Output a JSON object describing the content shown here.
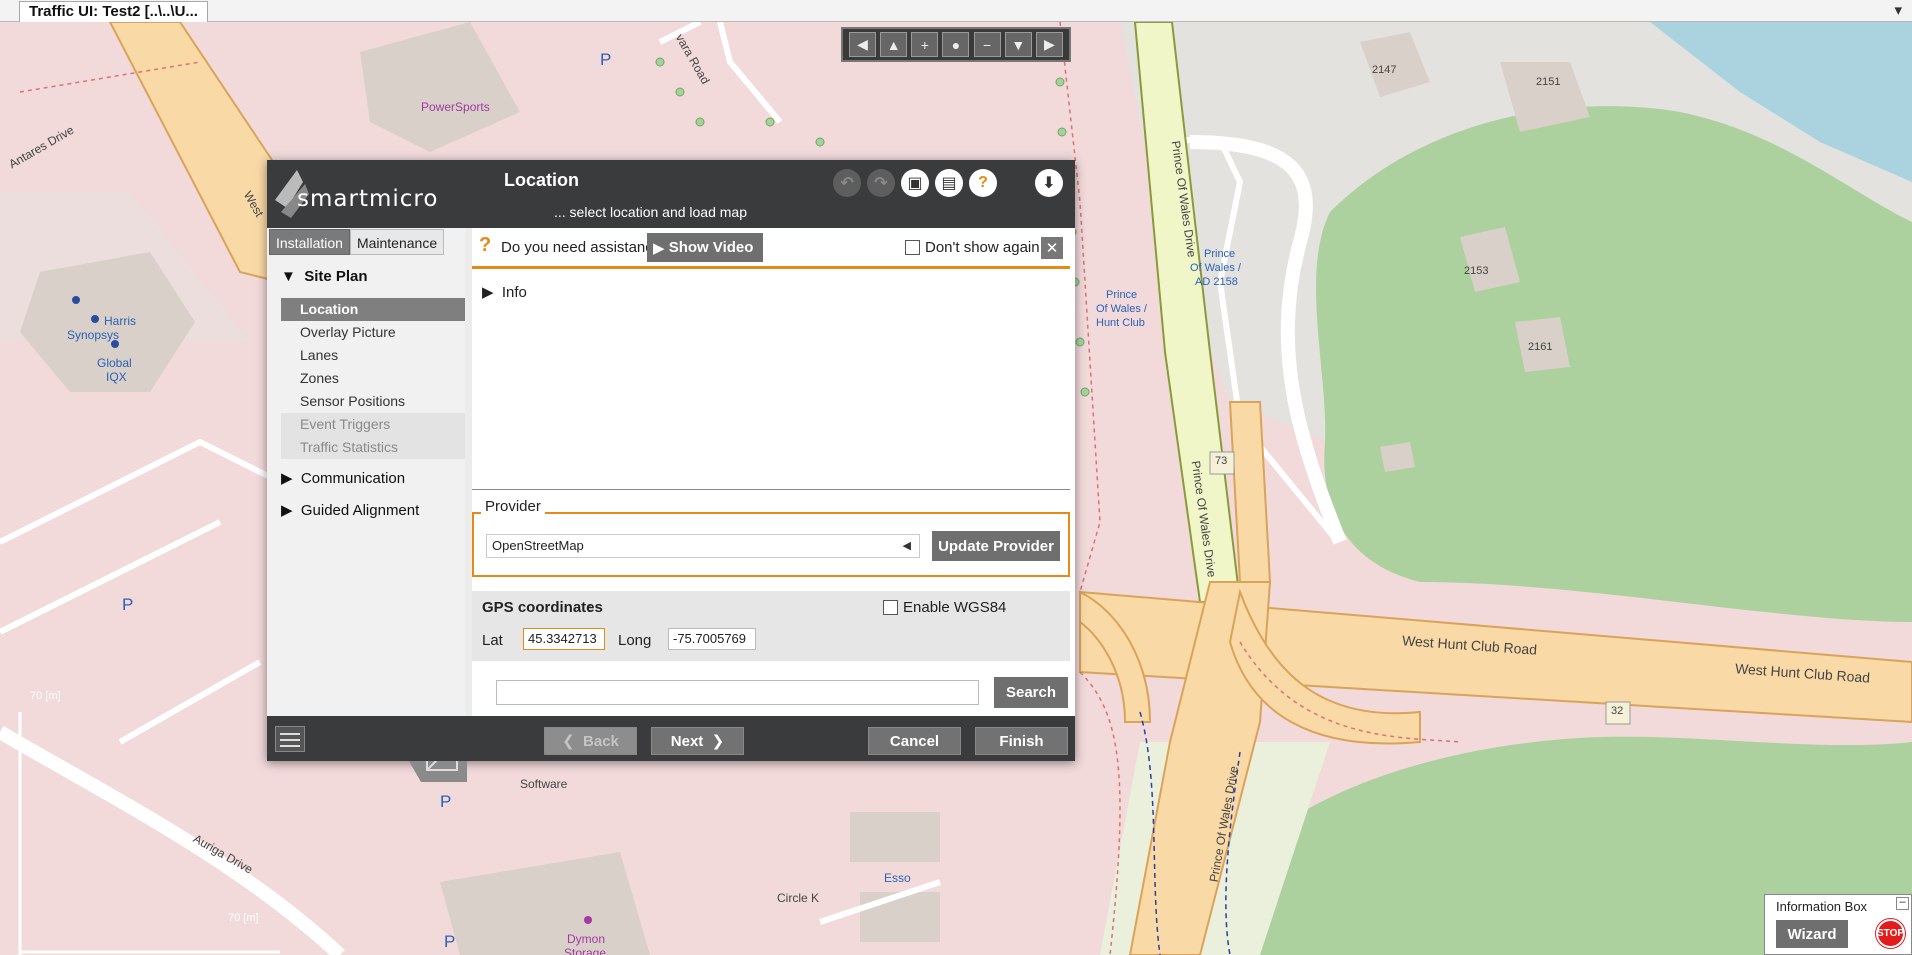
{
  "window": {
    "tab_title": "Traffic UI: Test2 [..\\..\\U..."
  },
  "map": {
    "streets": [
      "Antares Drive",
      "West",
      "Prince Of Wales Drive",
      "West Hunt Club Road",
      "Auriga Drive",
      "vara Road"
    ],
    "route_numbers": [
      "73",
      "32"
    ],
    "house_numbers": [
      "2147",
      "2151",
      "2153",
      "2161"
    ],
    "pois": [
      "PowerSports",
      "Harris",
      "Synopsys",
      "Global",
      "IQX",
      "Esso",
      "Circle K",
      "Dymon",
      "Storage",
      "Software"
    ],
    "bus_stops": [
      "Prince",
      "Of Wales /",
      "Hunt Club",
      "Prince",
      "Of Wales /",
      "AD 2158"
    ],
    "parking_symbol": "P",
    "scale_labels": [
      "70 [m]",
      "70 [m]"
    ]
  },
  "nav_controls": {
    "left": "◀",
    "up": "▲",
    "zoom_in": "+",
    "center": "●",
    "zoom_out": "−",
    "down": "▼",
    "right": "▶"
  },
  "dialog": {
    "brand": "smartmicro",
    "title": "Location",
    "subtitle": "... select location and load map",
    "icons": {
      "undo": "undo-icon",
      "redo": "redo-icon",
      "save": "save-icon",
      "save_as": "save-as-icon",
      "help": "help-icon",
      "download": "download-icon"
    },
    "tabs": [
      "Installation",
      "Maintenance"
    ],
    "sidebar": {
      "site_plan": "Site Plan",
      "items": [
        "Location",
        "Overlay Picture",
        "Lanes",
        "Zones",
        "Sensor Positions",
        "Event Triggers",
        "Traffic Statistics"
      ],
      "communication": "Communication",
      "guided_alignment": "Guided Alignment"
    },
    "assist": {
      "question_mark": "?",
      "text": "Do you need assistance?",
      "show_video": "Show Video",
      "dont_show": "Don't show again",
      "close": "✕"
    },
    "info_label": "Info",
    "provider": {
      "legend": "Provider",
      "selected": "OpenStreetMap",
      "update_button": "Update Provider"
    },
    "gps": {
      "label": "GPS coordinates",
      "colon": ":",
      "wgs84_label": "Enable WGS84",
      "lat_label": "Lat",
      "lat_value": "45.3342713",
      "long_label": "Long",
      "long_value": "-75.7005769"
    },
    "search": {
      "value": "",
      "button": "Search"
    },
    "footer": {
      "back": "Back",
      "next": "Next",
      "cancel": "Cancel",
      "finish": "Finish"
    }
  },
  "info_box": {
    "title": "Information Box",
    "minimize": "–",
    "wizard": "Wizard",
    "stop": "STOP"
  },
  "colors": {
    "accent": "#e58a14",
    "dialog_dark": "#3a3b3d",
    "road_orange": "#f9d9a6",
    "park_green": "#add19e",
    "residential_pink": "#f2dadb",
    "water": "#aad3df"
  }
}
